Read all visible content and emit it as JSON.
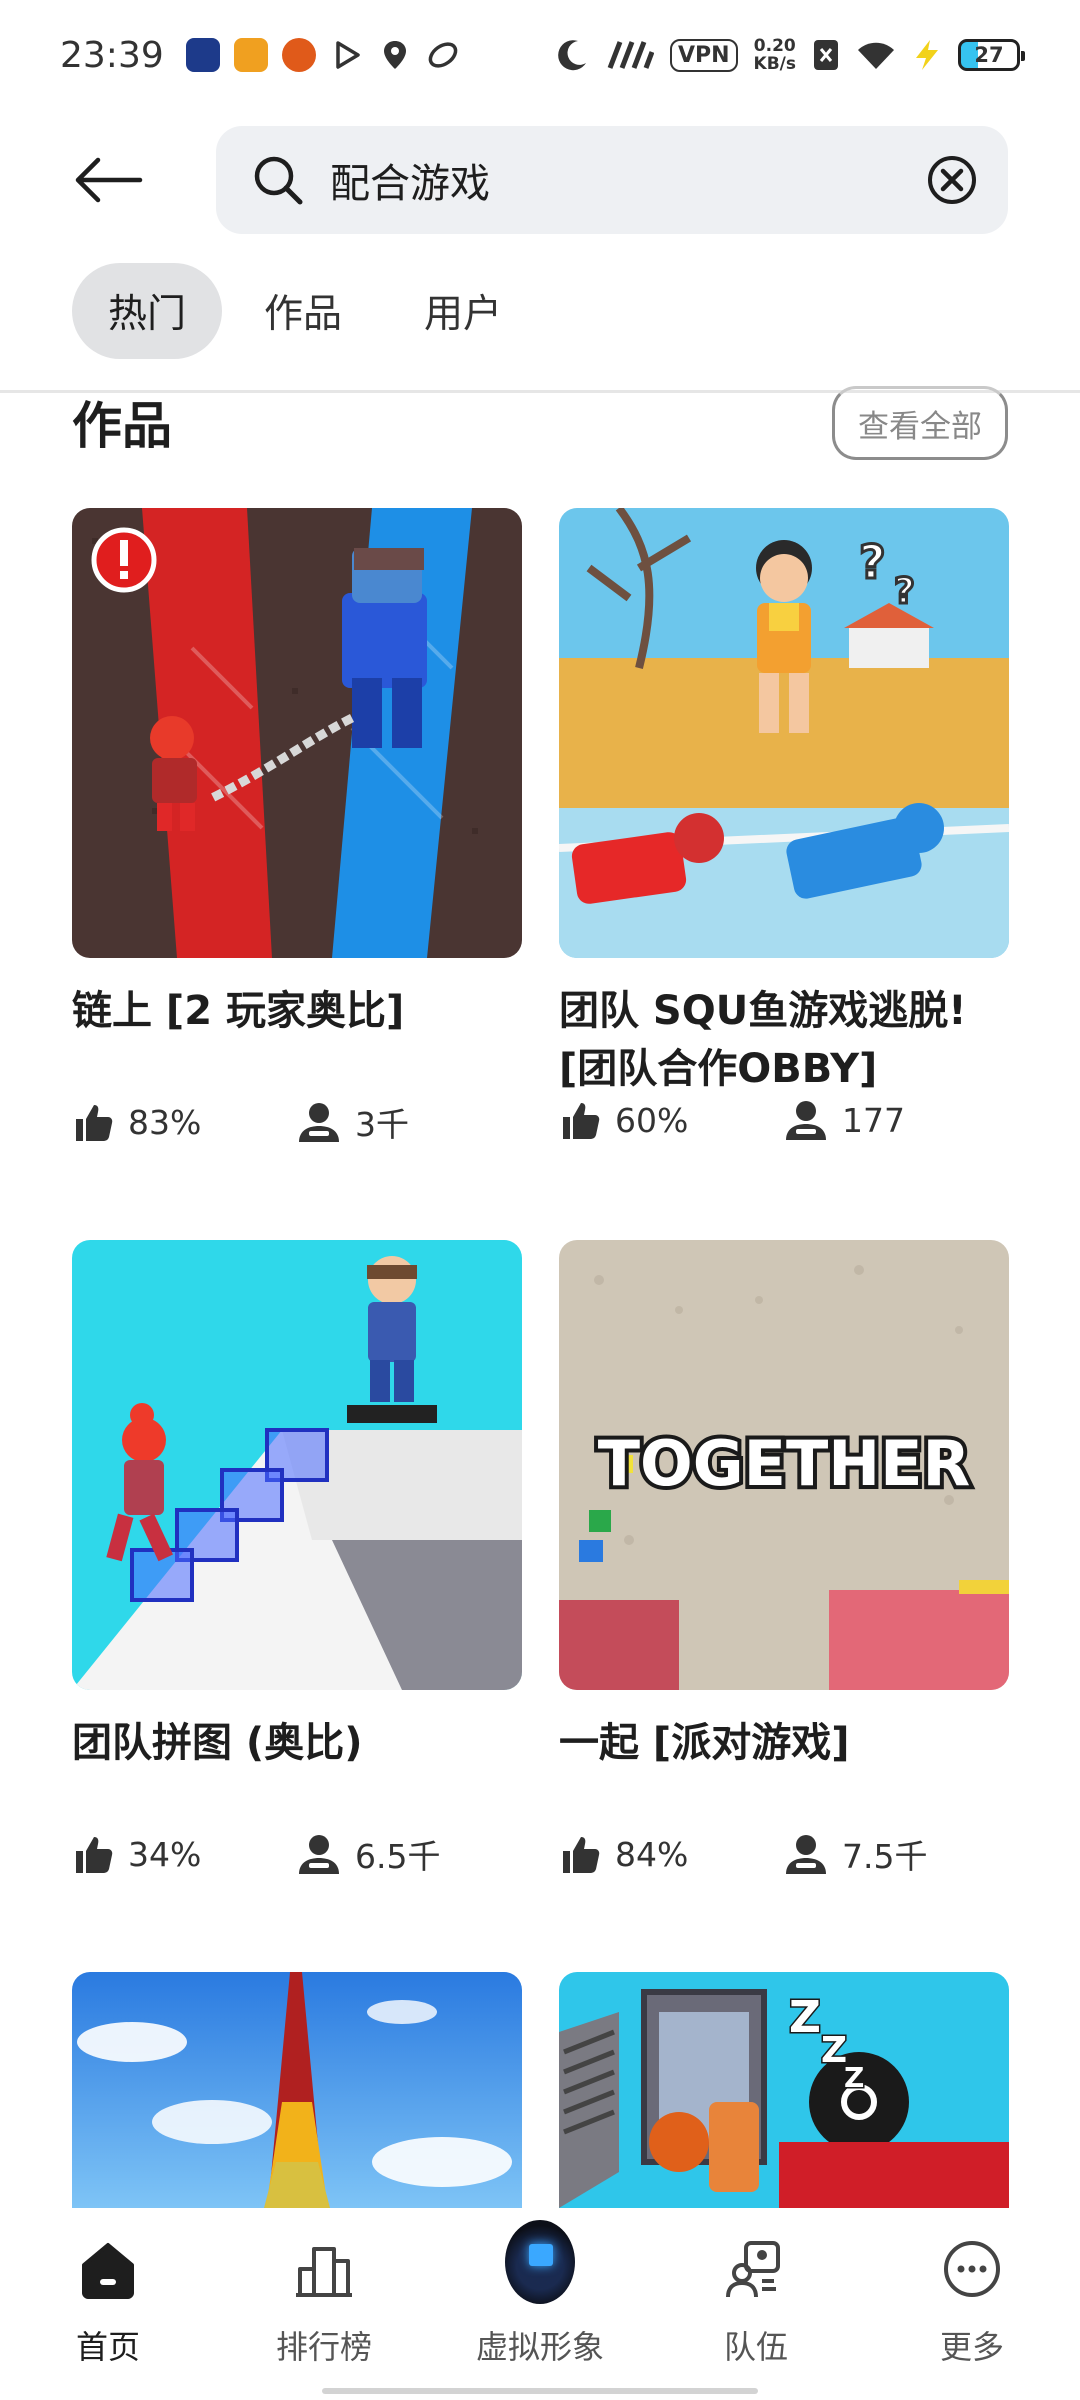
{
  "status_bar": {
    "time": "23:39",
    "vpn": "VPN",
    "net_speed_value": "0.20",
    "net_speed_unit": "KB/s",
    "battery": "27",
    "app_icons": [
      "app-1",
      "app-2",
      "app-3",
      "play",
      "location",
      "leaf"
    ]
  },
  "search": {
    "query": "配合游戏"
  },
  "tabs": [
    {
      "label": "热门",
      "active": true
    },
    {
      "label": "作品",
      "active": false
    },
    {
      "label": "用户",
      "active": false
    }
  ],
  "section": {
    "title": "作品",
    "view_all": "查看全部"
  },
  "games": [
    {
      "title": "链上 [2 玩家奥比]",
      "like": "83%",
      "players": "3千"
    },
    {
      "title": "团队 SQU鱼游戏逃脱! [团队合作OBBY]",
      "like": "60%",
      "players": "177"
    },
    {
      "title": "团队拼图 (奥比)",
      "like": "34%",
      "players": "6.5千"
    },
    {
      "title": "一起 [派对游戏]",
      "like": "84%",
      "players": "7.5千"
    },
    {
      "title": "",
      "like": "",
      "players": ""
    },
    {
      "title": "",
      "like": "",
      "players": ""
    }
  ],
  "thumb_text": {
    "together": "TOGETHER"
  },
  "bottom_nav": [
    {
      "label": "首页",
      "icon": "home-icon"
    },
    {
      "label": "排行榜",
      "icon": "leaderboard-icon"
    },
    {
      "label": "虚拟形象",
      "icon": "avatar-icon"
    },
    {
      "label": "队伍",
      "icon": "team-icon"
    },
    {
      "label": "更多",
      "icon": "more-icon"
    }
  ],
  "colors": {
    "search_bg": "#eef0f3",
    "active_tab_bg": "#e1e2e4",
    "text_primary": "#1e1e1e"
  }
}
